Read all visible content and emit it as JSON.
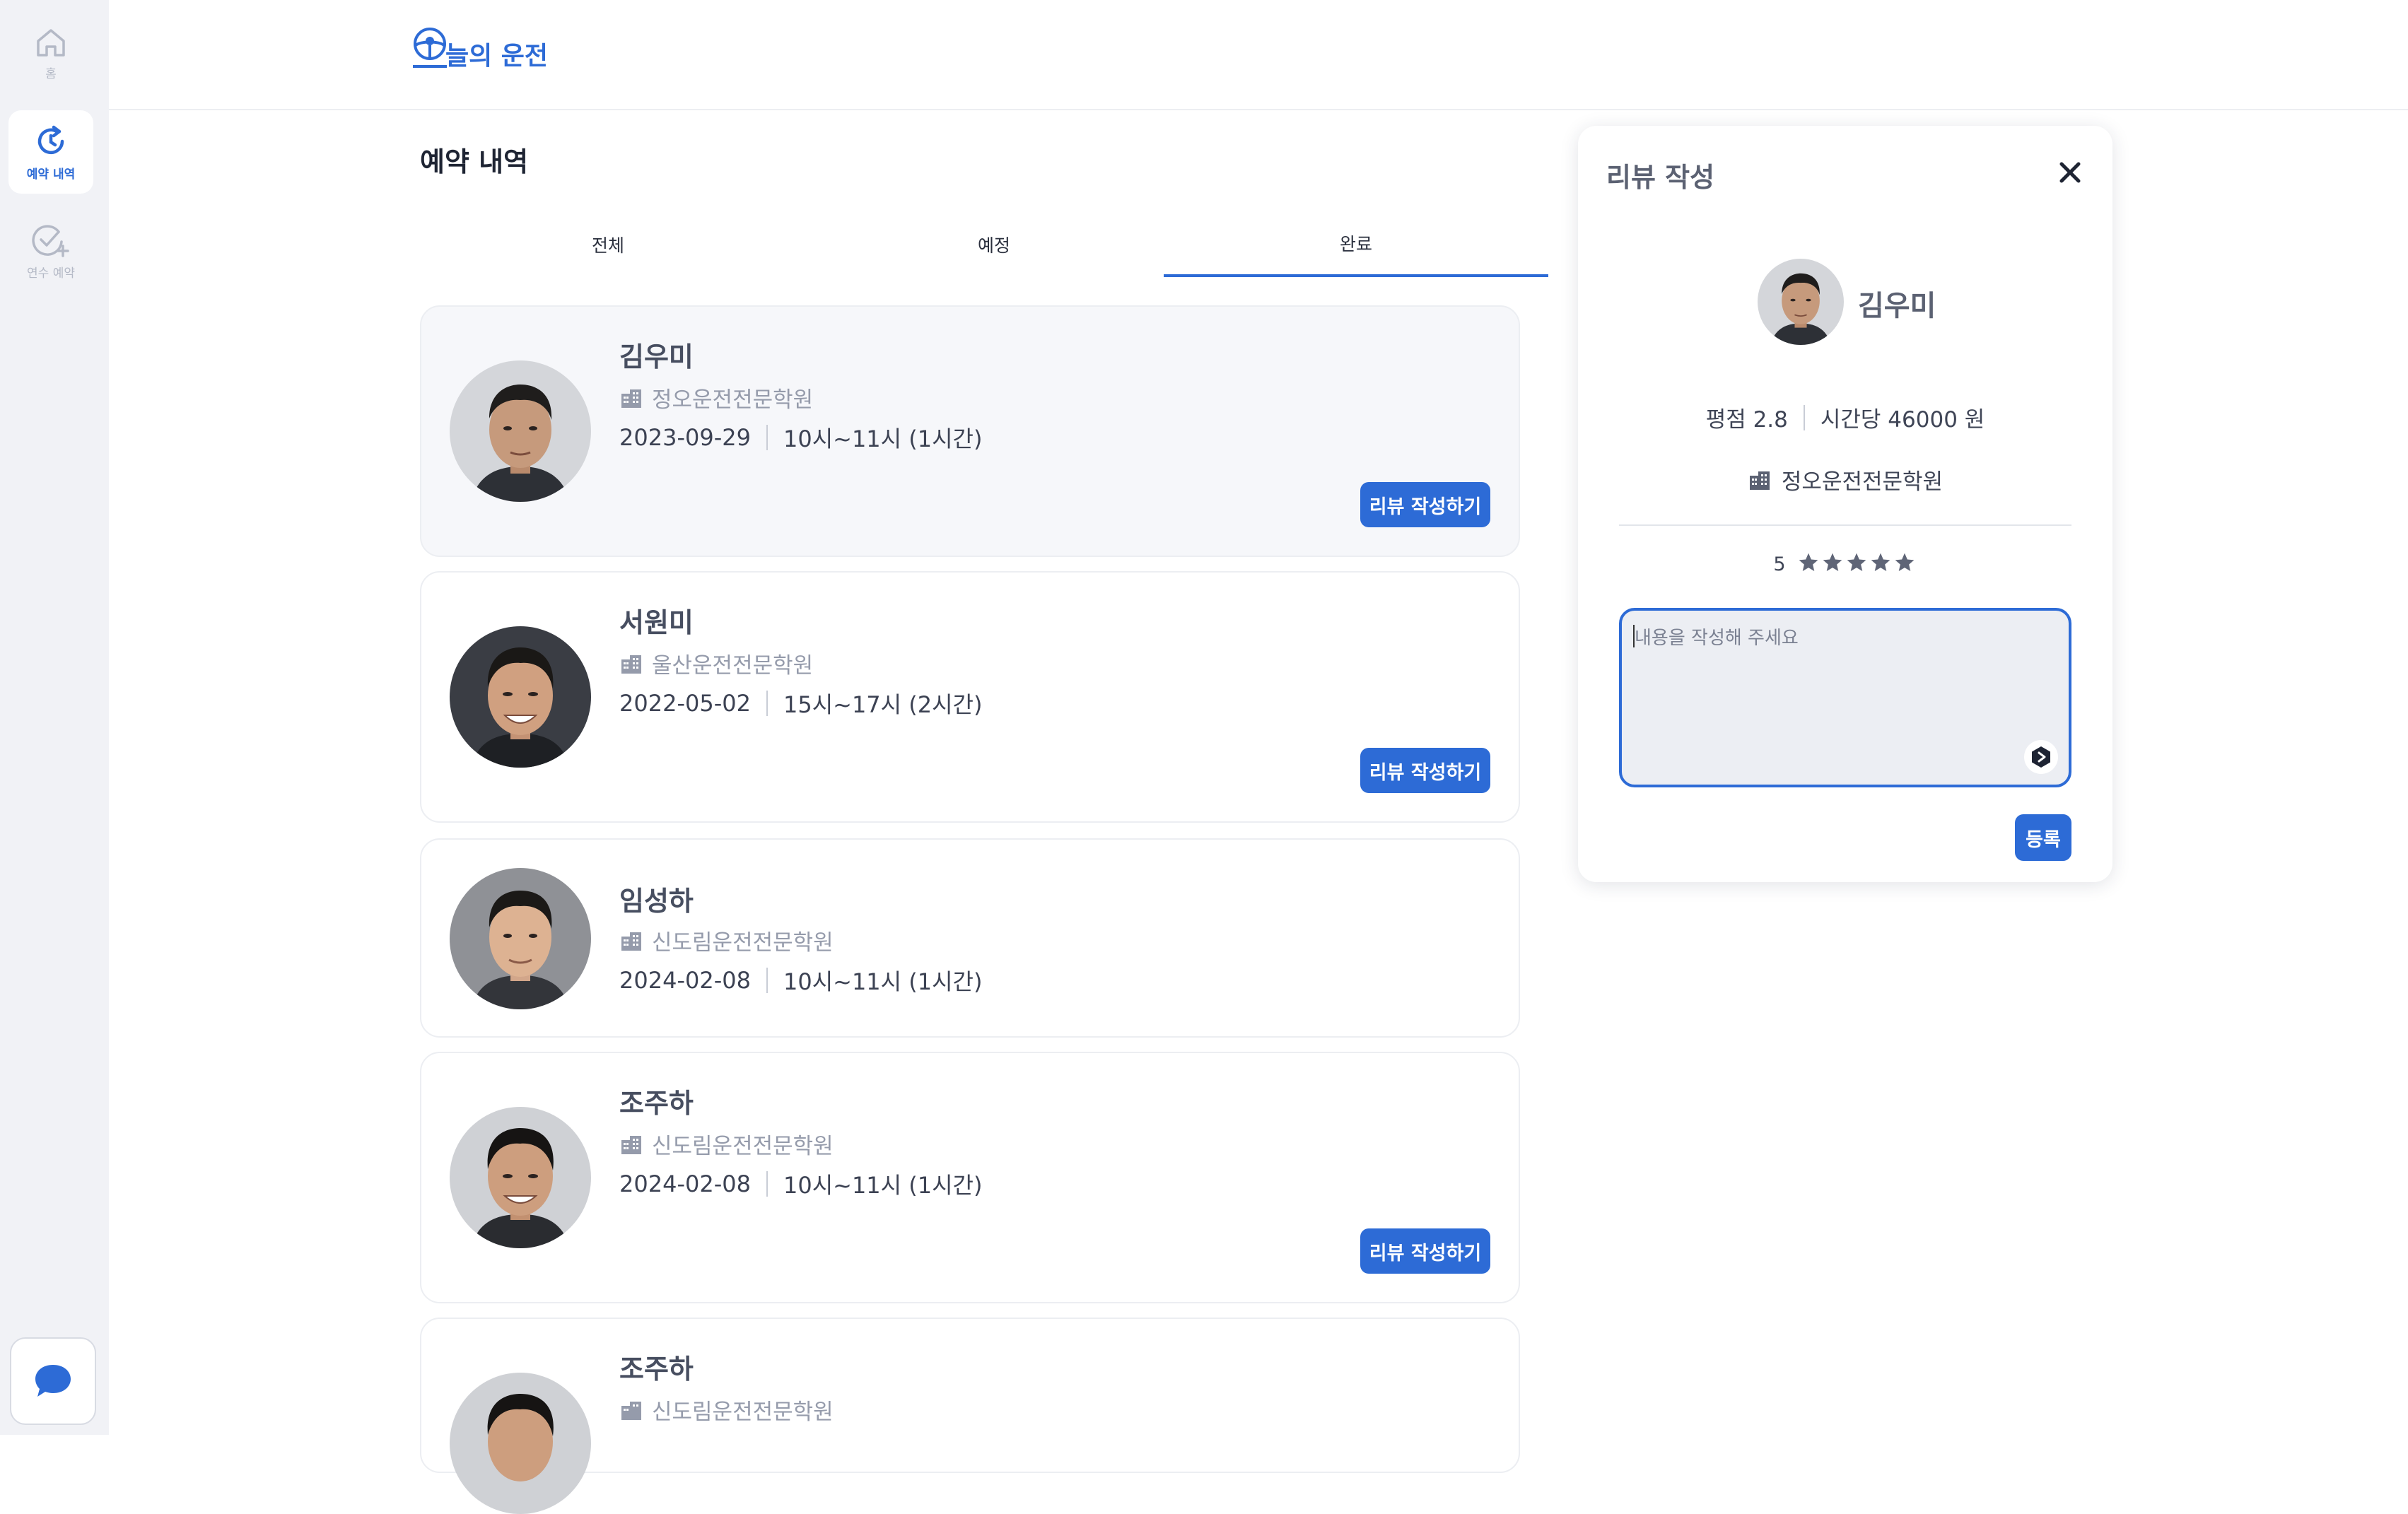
{
  "sidebar": {
    "items": [
      {
        "label": "홈",
        "icon": "home-icon"
      },
      {
        "label": "예약 내역",
        "icon": "history-icon"
      },
      {
        "label": "연수 예약",
        "icon": "check-plus-icon"
      }
    ],
    "chat_icon": "chat-bubble-icon"
  },
  "header": {
    "logo_text": "늘의 운전"
  },
  "main": {
    "title": "예약 내역",
    "tabs": [
      {
        "label": "전체"
      },
      {
        "label": "예정"
      },
      {
        "label": "완료",
        "active": true
      }
    ],
    "cards": [
      {
        "name": "김우미",
        "academy": "정오운전전문학원",
        "date": "2023-09-29",
        "time": "10시~11시 (1시간)",
        "button": "리뷰 작성하기"
      },
      {
        "name": "서원미",
        "academy": "울산운전전문학원",
        "date": "2022-05-02",
        "time": "15시~17시 (2시간)",
        "button": "리뷰 작성하기"
      },
      {
        "name": "임성하",
        "academy": "신도림운전전문학원",
        "date": "2024-02-08",
        "time": "10시~11시 (1시간)"
      },
      {
        "name": "조주하",
        "academy": "신도림운전전문학원",
        "date": "2024-02-08",
        "time": "10시~11시 (1시간)",
        "button": "리뷰 작성하기"
      },
      {
        "name": "조주하",
        "academy": "신도림운전전문학원"
      }
    ]
  },
  "panel": {
    "title": "리뷰 작성",
    "name": "김우미",
    "rating_label": "평점 2.8",
    "price_label": "시간당 46000 원",
    "academy": "정오운전전문학원",
    "stars_value": "5",
    "star_count": 5,
    "placeholder": "내용을 작성해 주세요",
    "submit": "등록"
  },
  "colors": {
    "accent": "#2d6bd6",
    "star": "#5f6577",
    "sidebar_bg": "#f1f2f6"
  }
}
